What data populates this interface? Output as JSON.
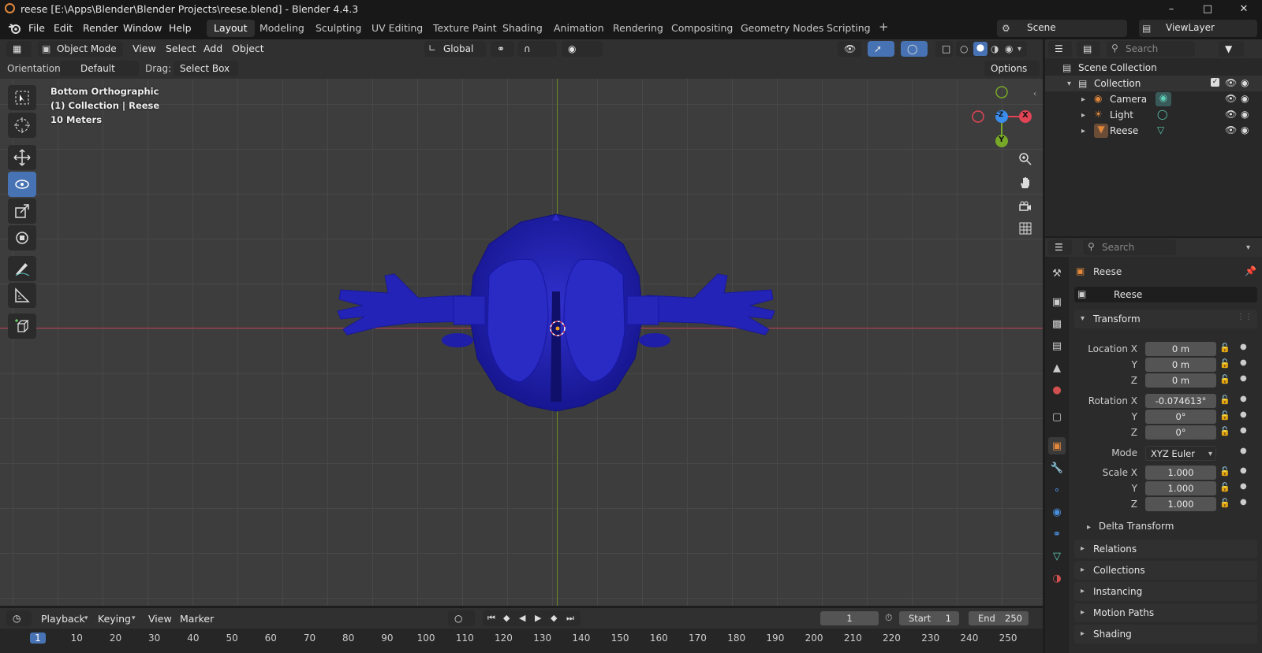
{
  "window": {
    "title": "reese [E:\\Apps\\Blender\\Blender Projects\\reese.blend] - Blender 4.4.3",
    "minimize": "–",
    "maximize": "□",
    "close": "✕"
  },
  "menu": {
    "items": [
      "File",
      "Edit",
      "Render",
      "Window",
      "Help"
    ]
  },
  "workspaces": {
    "tabs": [
      "Layout",
      "Modeling",
      "Sculpting",
      "UV Editing",
      "Texture Paint",
      "Shading",
      "Animation",
      "Rendering",
      "Compositing",
      "Geometry Nodes",
      "Scripting"
    ],
    "add": "+"
  },
  "scene": {
    "name": "Scene"
  },
  "viewlayer": {
    "name": "ViewLayer"
  },
  "viewport_header": {
    "mode": "Object Mode",
    "menus": [
      "View",
      "Select",
      "Add",
      "Object"
    ],
    "transform_orientation": "Global"
  },
  "tool_settings": {
    "orientation_label": "Orientation:",
    "orientation_value": "Default",
    "drag_label": "Drag:",
    "drag_value": "Select Box",
    "options": "Options"
  },
  "viewport": {
    "view_name": "Bottom Orthographic",
    "collection_info": "(1) Collection | Reese",
    "scale_info": "10 Meters",
    "gizmo": {
      "x": "X",
      "y": "Y",
      "z": "-Z"
    }
  },
  "outliner": {
    "search_placeholder": "Search",
    "scene_collection": "Scene Collection",
    "collection": "Collection",
    "items": [
      {
        "name": "Camera",
        "icon": "camera-icon"
      },
      {
        "name": "Light",
        "icon": "light-icon"
      },
      {
        "name": "Reese",
        "icon": "mesh-icon"
      }
    ]
  },
  "properties": {
    "search_placeholder": "Search",
    "object_name": "Reese",
    "object_field": "Reese",
    "transform_title": "Transform",
    "location_label": "Location X",
    "location": [
      "0 m",
      "0 m",
      "0 m"
    ],
    "rotation_label": "Rotation X",
    "rotation": [
      "-0.074613°",
      "0°",
      "0°"
    ],
    "mode_label": "Mode",
    "mode_value": "XYZ Euler",
    "scale_label": "Scale X",
    "scale": [
      "1.000",
      "1.000",
      "1.000"
    ],
    "axis_y": "Y",
    "axis_z": "Z",
    "delta_transform": "Delta Transform",
    "panels": [
      "Relations",
      "Collections",
      "Instancing",
      "Motion Paths",
      "Shading"
    ]
  },
  "timeline": {
    "menus": [
      "Playback",
      "Keying",
      "View",
      "Marker"
    ],
    "current_frame": "1",
    "start_label": "Start",
    "start": "1",
    "end_label": "End",
    "end": "250",
    "ticks": [
      "1",
      "10",
      "20",
      "30",
      "40",
      "50",
      "60",
      "70",
      "80",
      "90",
      "100",
      "110",
      "120",
      "130",
      "140",
      "150",
      "160",
      "170",
      "180",
      "190",
      "200",
      "210",
      "220",
      "230",
      "240",
      "250"
    ]
  },
  "colors": {
    "accent": "#4772b3",
    "mesh": "#1a1ab0",
    "x_axis": "#e04455",
    "y_axis": "#77a828",
    "z_axis": "#3b8dea"
  }
}
